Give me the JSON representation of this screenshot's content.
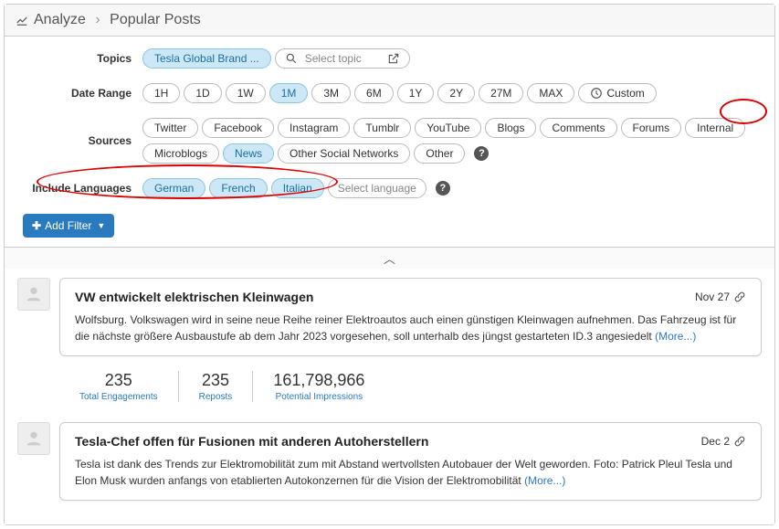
{
  "breadcrumb": {
    "root": "Analyze",
    "page": "Popular Posts"
  },
  "filters": {
    "topics": {
      "label": "Topics",
      "selected": "Tesla Global Brand ...",
      "placeholder": "Select topic"
    },
    "dateRange": {
      "label": "Date Range",
      "options": [
        "1H",
        "1D",
        "1W",
        "1M",
        "3M",
        "6M",
        "1Y",
        "2Y",
        "27M",
        "MAX"
      ],
      "custom": "Custom",
      "active": "1M"
    },
    "sources": {
      "label": "Sources",
      "options": [
        "Twitter",
        "Facebook",
        "Instagram",
        "Tumblr",
        "YouTube",
        "Blogs",
        "Comments",
        "Forums",
        "Internal",
        "Microblogs",
        "News",
        "Other Social Networks",
        "Other"
      ],
      "active": [
        "News"
      ]
    },
    "languages": {
      "label": "Include Languages",
      "selected": [
        "German",
        "French",
        "Italian"
      ],
      "placeholder": "Select language"
    },
    "addFilter": "Add Filter"
  },
  "posts": [
    {
      "title": "VW entwickelt elektrischen Kleinwagen",
      "date": "Nov 27",
      "text": "Wolfsburg. Volkswagen wird in seine neue Reihe reiner Elektroautos auch einen günstigen Kleinwagen aufnehmen. Das Fahrzeug ist für die nächste größere Ausbaustufe ab dem Jahr 2023 vorgesehen, soll unterhalb des jüngst gestarteten ID.3 angesiedelt",
      "more": "(More...)",
      "stats": [
        {
          "value": "235",
          "label": "Total Engagements"
        },
        {
          "value": "235",
          "label": "Reposts"
        },
        {
          "value": "161,798,966",
          "label": "Potential Impressions"
        }
      ]
    },
    {
      "title": "Tesla-Chef offen für Fusionen mit anderen Autoherstellern",
      "date": "Dec 2",
      "text": "Tesla ist dank des Trends zur Elektromobilität zum mit Abstand wertvollsten Autobauer der Welt geworden. Foto: Patrick Pleul Tesla und Elon Musk wurden anfangs von etablierten Autokonzernen für die Vision der Elektromobilität",
      "more": "(More...)"
    }
  ]
}
